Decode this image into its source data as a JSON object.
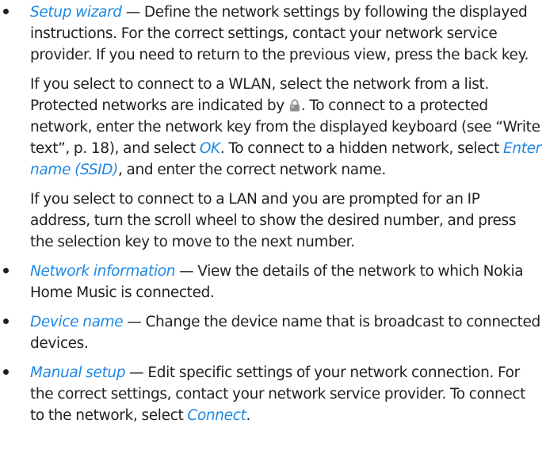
{
  "colors": {
    "text": "#231f20",
    "link": "#1e88e5"
  },
  "items": [
    {
      "term": "Setup wizard",
      "desc": " — Define the network settings by following the displayed instructions. For the correct settings, contact your network service provider. If you need to return to the previous view, press the back key."
    },
    {
      "term": "Network information",
      "desc": " — View the details of the network to which Nokia Home Music is connected."
    },
    {
      "term": "Device name",
      "desc": " — Change the device name that is broadcast to connected devices."
    },
    {
      "term": "Manual setup",
      "desc": " — Edit specific settings of your network connection. For the correct settings, contact your network service provider. To connect to the network, select ",
      "link": "Connect",
      "end": "."
    }
  ],
  "wlan_paragraph": {
    "p1": "If you select to connect to a WLAN, select the network from a list. Protected networks are indicated by ",
    "icon": "lock-icon",
    "p2": ". To connect to a protected network, enter the network key from the displayed keyboard (see “Write text”, p. 18), and select ",
    "ok": "OK",
    "p3": ". To connect to a hidden network, select ",
    "ssid": "Enter name (SSID)",
    "p4": ", and enter the correct network name."
  },
  "lan_paragraph": "If you select to connect to a LAN and you are prompted for an IP address, turn the scroll wheel to show the desired number, and press the selection key to move to the next number."
}
